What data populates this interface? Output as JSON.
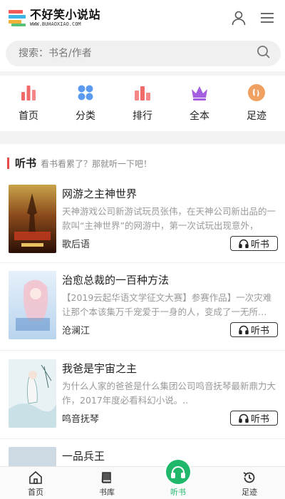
{
  "header": {
    "logo_name": "不好笑小说站",
    "logo_url": "WWW.BUHAOXIAO.COM",
    "user_icon": "user-icon",
    "menu_icon": "menu-icon"
  },
  "search": {
    "placeholder": "搜索：书名/作者",
    "icon": "search-icon"
  },
  "categories": [
    {
      "label": "首页",
      "icon": "bar-chart-icon",
      "color": "#f06a6a"
    },
    {
      "label": "分类",
      "icon": "grid-dots-icon",
      "color": "#5a9bf0"
    },
    {
      "label": "排行",
      "icon": "ranking-icon",
      "color": "#f06a6a"
    },
    {
      "label": "全本",
      "icon": "crown-icon",
      "color": "#a45ee0"
    },
    {
      "label": "足迹",
      "icon": "footprint-icon",
      "color": "#f0a060"
    }
  ],
  "section": {
    "title": "听书",
    "subtitle": "看书看累了？那就听一下吧！"
  },
  "books": [
    {
      "title": "网游之主神世界",
      "desc": "天神游戏公司新游试玩员张伟，在天神公司新出品的一款叫“主神世界”的网游中，第一次试玩出现意外，",
      "author": "歌后语",
      "button": "听书"
    },
    {
      "title": "治愈总裁的一百种方法",
      "desc": "【2019云起华语文学征文大赛】参赛作品】一次灾难让那个本该集万千宠爱于一身的人，变成了一无所…",
      "author": "沧澜江",
      "button": "听书"
    },
    {
      "title": "我爸是宇宙之主",
      "desc": "为什么人家的爸爸是什么集团公司鸣音抚琴最新鼎力大作，2017年度必看科幻小说。..",
      "author": "鸣音抚琴",
      "button": "听书"
    },
    {
      "title": "一品兵王",
      "desc": "",
      "author": "",
      "button": ""
    }
  ],
  "bottom_nav": [
    {
      "label": "首页",
      "icon": "home-icon",
      "active": false
    },
    {
      "label": "书库",
      "icon": "book-icon",
      "active": false
    },
    {
      "label": "听书",
      "icon": "headphones-icon",
      "active": true
    },
    {
      "label": "足迹",
      "icon": "history-icon",
      "active": false
    }
  ],
  "colors": {
    "accent": "#1fb86b",
    "section_bar": "#e84a4a",
    "search_bg": "#f0f0f0"
  }
}
